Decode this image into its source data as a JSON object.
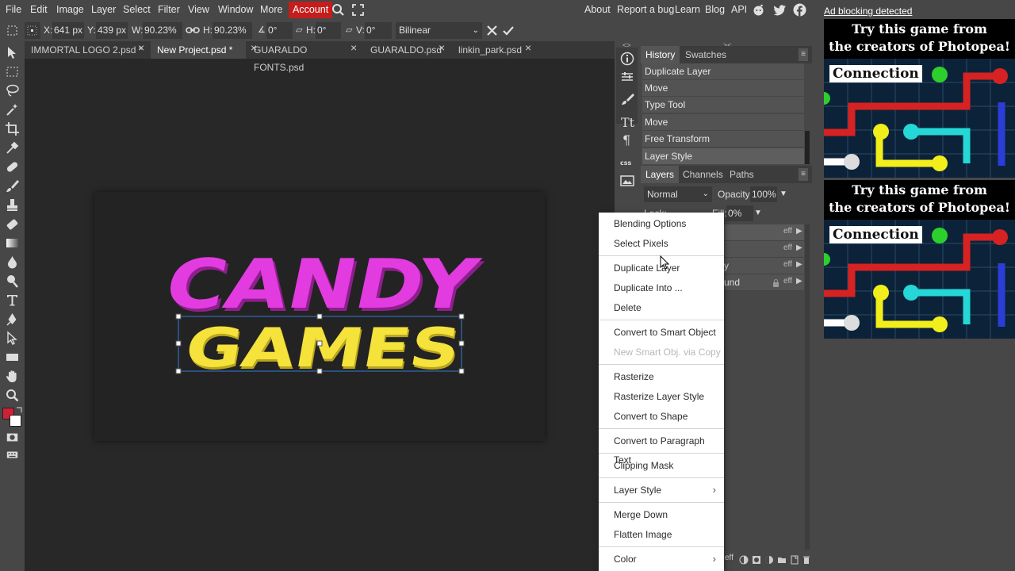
{
  "menubar": {
    "items": [
      "File",
      "Edit",
      "Image",
      "Layer",
      "Select",
      "Filter",
      "View",
      "Window",
      "More"
    ],
    "account": "Account",
    "right_links": [
      "About",
      "Report a bug",
      "Learn",
      "Blog",
      "API"
    ]
  },
  "options": {
    "x_label": "X:",
    "x_value": "641 px",
    "y_label": "Y:",
    "y_value": "439 px",
    "w_label": "W:",
    "w_value": "90.23%",
    "h_label": "H:",
    "h_value": "90.23%",
    "angle_value": "0°",
    "skew_h_label": "H:",
    "skew_h_value": "0°",
    "skew_v_label": "V:",
    "skew_v_value": "0°",
    "interpolation": "Bilinear"
  },
  "tabs": [
    {
      "label": "IMMORTAL LOGO 2.psd *",
      "active": false
    },
    {
      "label": "New Project.psd *",
      "active": true
    },
    {
      "label": "GUARALDO FONTS.psd",
      "active": false
    },
    {
      "label": "GUARALDO.psd",
      "active": false
    },
    {
      "label": "linkin_park.psd",
      "active": false
    }
  ],
  "canvas": {
    "line1": "CANDY",
    "line2": "GAMES",
    "colors": {
      "candy": "#e23ce0",
      "candy_shadow": "#8e1f8c",
      "games": "#f5e23a",
      "games_shadow": "#b8a51f"
    }
  },
  "history_panel": {
    "tabs": [
      "History",
      "Swatches"
    ],
    "items": [
      "Duplicate Layer",
      "Move",
      "Type Tool",
      "Move",
      "Free Transform",
      "Layer Style"
    ]
  },
  "layers_panel": {
    "tabs": [
      "Layers",
      "Channels",
      "Paths"
    ],
    "blend_mode": "Normal",
    "opacity_label": "Opacity:",
    "opacity_value": "100%",
    "lock_label": "Lock:",
    "fill_label": "Fill:",
    "fill_value": "0%",
    "layer_fragments": [
      "y",
      "und"
    ],
    "eff_label": "eff"
  },
  "context_menu": {
    "groups": [
      [
        "Blending Options",
        "Select Pixels"
      ],
      [
        "Duplicate Layer",
        "Duplicate Into ...",
        "Delete"
      ],
      [
        "Convert to Smart Object",
        "New Smart Obj. via Copy"
      ],
      [
        "Rasterize",
        "Rasterize Layer Style",
        "Convert to Shape"
      ],
      [
        "Convert to Paragraph Text"
      ],
      [
        "Clipping Mask"
      ],
      [
        "Layer Style"
      ],
      [
        "Merge Down",
        "Flatten Image"
      ],
      [
        "Color"
      ]
    ],
    "disabled": [
      "New Smart Obj. via Copy"
    ]
  },
  "ads": {
    "notice": "Ad blocking detected",
    "boxes": [
      {
        "title_line1": "Try this game from",
        "title_line2": "the creators of Photopea!",
        "game_title": "Connection"
      },
      {
        "title_line1": "Try this game from",
        "title_line2": "the creators of Photopea!",
        "game_title": "Connection"
      }
    ]
  },
  "colors": {
    "foreground": "#d11f36",
    "background": "#ffffff",
    "accent_account": "#c41d1d"
  }
}
